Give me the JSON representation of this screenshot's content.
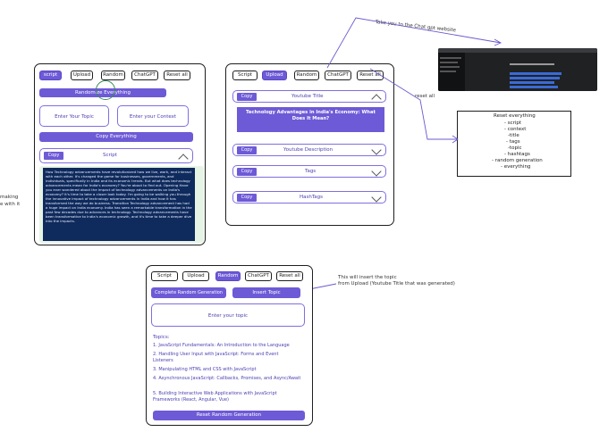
{
  "colors": {
    "accent": "#6d5ad6",
    "dark_panel": "#0f2a5c",
    "highlight": "#e6f4e6",
    "line": "#6a5acd"
  },
  "tabs": [
    "script",
    "Upload",
    "Random",
    "ChatGPT",
    "Reset all"
  ],
  "tabs_b": [
    "Script",
    "Upload",
    "Random",
    "ChatGPT",
    "Reset all"
  ],
  "mock1": {
    "randomize_label": "Randomize Everything",
    "topic_placeholder": "Enter Your Topic",
    "context_placeholder": "Enter your Context",
    "copy_everything": "Copy Everything",
    "copy": "Copy",
    "section_title": "Script",
    "script_text": "How Technology advancements have revolutionized how we live, work, and interact with each other. It's changed the game for businesses, governments, and individuals, specifically in India and its economic trends. But what does technology advancements mean for India's economy? You're about to find out. Opening Have you ever wondered about the impact of technology advancements on India's economy? It's time to take a closer look today. I'm going to be walking you through the innovative impact of technology advancements in India and how it has transformed the way we do business. Transition Technology advancement has had a huge impact on India economy. India has seen a remarkable transformation in the past few decades due to advances in technology. Technology advancements have been transformative to India's economic growth, and it's time to take a deeper dive into the impacts."
  },
  "left_clip_text": [
    "making",
    "e with it"
  ],
  "mock2": {
    "copy": "Copy",
    "sections": [
      "Youtube Title",
      "Youtube Description",
      "Tags",
      "HashTags"
    ],
    "title_text": "Technology Advantages in India's Economy: What Does It Mean?"
  },
  "annotations": {
    "chatgpt_note": "Take you to the Chat gpt website",
    "reset_note": "reset all",
    "reset_box_lines": [
      "Reset everything",
      "- script",
      "- context",
      "-title",
      "- tags",
      "-topic",
      "- hashtags",
      "- random generation",
      "- everything"
    ],
    "insert_note_1": "This will insert the topic",
    "insert_note_2": "from Upload (Youtube Title that was generated)"
  },
  "mock3": {
    "complete_random": "Complete Random Generation",
    "insert_topic": "Insert Topic",
    "topic_placeholder": "Enter your topic",
    "topics_label": "Topics:",
    "topics": [
      "1. JavaScript Fundamentals: An Introduction to the Language",
      "2. Handling User Input with JavaScript: Forms and Event Listeners",
      "3. Manipulating HTML and CSS with JavaScript",
      "4. Asynchronous JavaScript: Callbacks, Promises, and Async/Await",
      "5. Building Interactive Web Applications with JavaScript Frameworks (React, Angular, Vue)"
    ],
    "reset_random": "Reset Random Generation"
  }
}
